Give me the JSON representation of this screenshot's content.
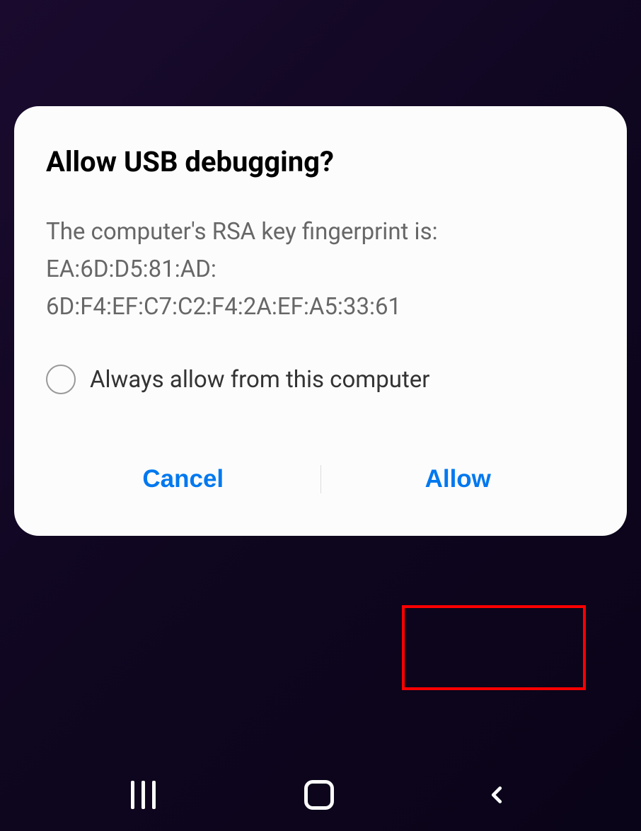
{
  "dialog": {
    "title": "Allow USB debugging?",
    "message": "The computer's RSA key fingerprint is:\nEA:6D:D5:81:AD:\n6D:F4:EF:C7:C2:F4:2A:EF:A5:33:61",
    "checkbox_label": "Always allow from this computer",
    "cancel_label": "Cancel",
    "allow_label": "Allow"
  }
}
